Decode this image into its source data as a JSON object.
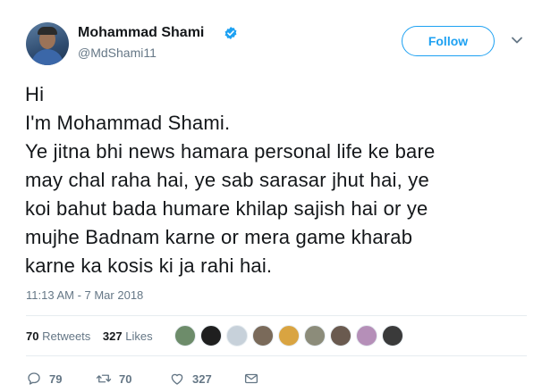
{
  "author": {
    "name": "Mohammad Shami",
    "handle": "@MdShami11",
    "verified": true
  },
  "follow_label": "Follow",
  "tweet": {
    "lines": [
      "Hi",
      "I'm Mohammad Shami.",
      "Ye jitna bhi news hamara personal life ke bare",
      "may chal raha hai, ye sab sarasar jhut hai, ye",
      "koi bahut bada humare khilap sajish hai or ye",
      "mujhe Badnam karne or mera game kharab",
      "karne ka kosis ki ja rahi hai."
    ],
    "timestamp": "11:13 AM - 7 Mar 2018"
  },
  "stats": {
    "retweets_count": "70",
    "retweets_label": "Retweets",
    "likes_count": "327",
    "likes_label": "Likes"
  },
  "likers": [
    {
      "color": "#6d8c6a"
    },
    {
      "color": "#1f1f1f"
    },
    {
      "color": "#c7d1da"
    },
    {
      "color": "#7a6a5a"
    },
    {
      "color": "#d9a441"
    },
    {
      "color": "#8c8c7a"
    },
    {
      "color": "#6a5a4f"
    },
    {
      "color": "#b58fb8"
    },
    {
      "color": "#3a3a3a"
    }
  ],
  "actions": {
    "reply_count": "79",
    "retweet_count": "70",
    "like_count": "327"
  },
  "colors": {
    "accent": "#1da1f2",
    "secondary_text": "#657786",
    "divider": "#e6ecf0"
  }
}
